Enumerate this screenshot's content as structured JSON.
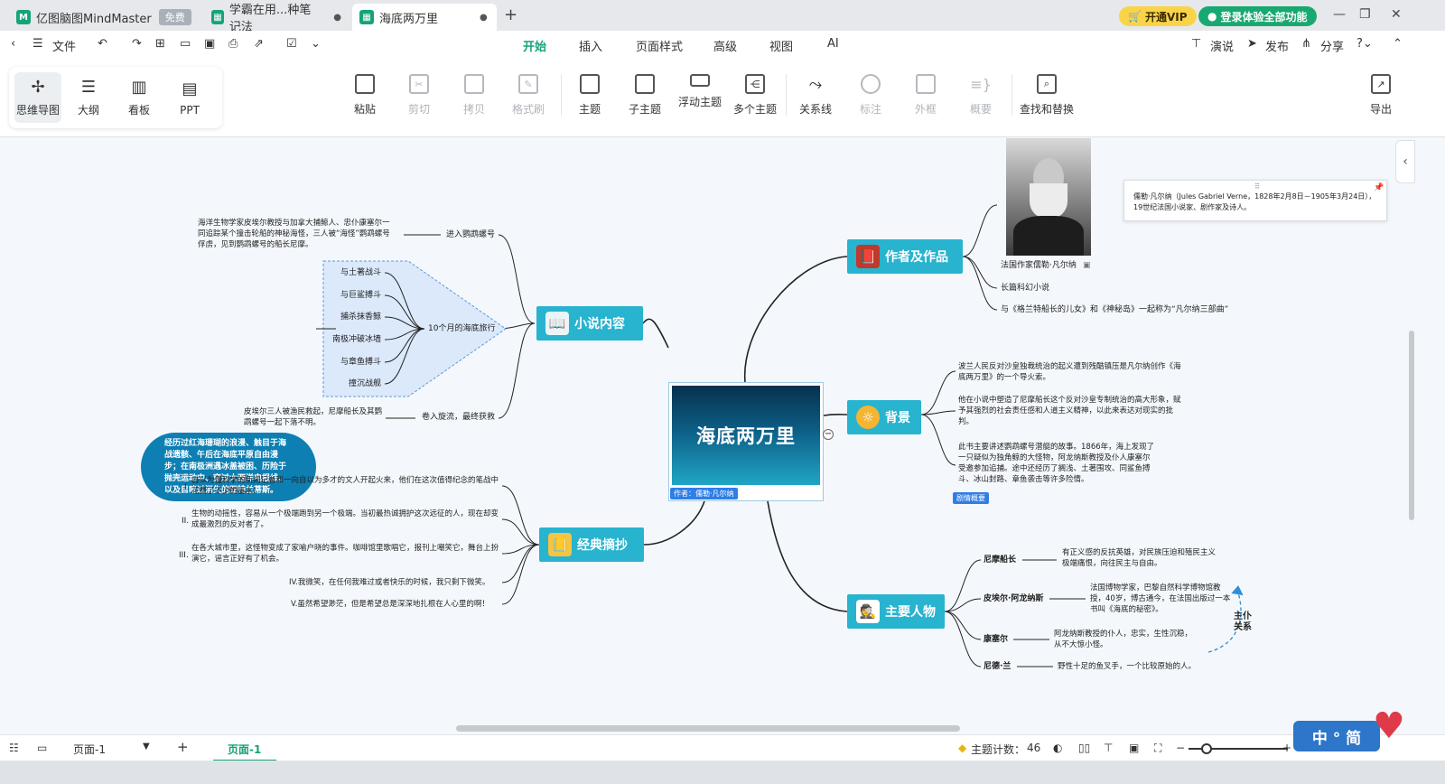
{
  "tabs": [
    {
      "label": "亿图脑图MindMaster",
      "badge": "免费"
    },
    {
      "label": "学霸在用...种笔记法"
    },
    {
      "label": "海底两万里"
    }
  ],
  "tab_add": "+",
  "header": {
    "vip": "开通VIP",
    "login": "登录体验全部功能"
  },
  "menu": {
    "file": "文件",
    "tabs": [
      "开始",
      "插入",
      "页面样式",
      "高级",
      "视图",
      "AI"
    ],
    "right": [
      "演说",
      "发布",
      "分享"
    ]
  },
  "views": [
    "思维导图",
    "大纲",
    "看板",
    "PPT"
  ],
  "ribbon": {
    "paste": "粘贴",
    "cut": "剪切",
    "copy": "拷贝",
    "format": "格式刷",
    "topic": "主题",
    "subtopic": "子主题",
    "float": "浮动主题",
    "multi": "多个主题",
    "relation": "关系线",
    "callout": "标注",
    "boundary": "外框",
    "summary": "概要",
    "find": "查找和替换",
    "export": "导出"
  },
  "map": {
    "center": "海底两万里",
    "center_tag": "作者：儒勒·凡尔纳",
    "branches": {
      "novel": "小说内容",
      "author": "作者及作品",
      "background": "背景",
      "quotes": "经典摘抄",
      "characters": "主要人物"
    },
    "novel": {
      "enter": "进入鹦鹉螺号",
      "enter_text": "海洋生物学家皮埃尔教授与加拿大捕鲸人、忠仆康塞尔一同追踪某个撞击轮船的神秘海怪，三人被“海怪”鹦鹉螺号俘虏，见到鹦鹉螺号的船长尼摩。",
      "journey": "10个月的海底旅行",
      "journey_items": [
        "与土著战斗",
        "与巨鲨搏斗",
        "捕杀抹香鲸",
        "南极冲破冰墙",
        "与章鱼搏斗",
        "撞沉战舰"
      ],
      "bubble": "经历过红海珊瑚的浪漫、触目于海战遗骸、午后在海底平原自由漫步；在南极洲遇冰盖被困、历险于抛壳运动中、穿过大西洋电报线、以及目睹过消失的亚特兰蒂斯。",
      "end": "卷入旋流，最终获救",
      "end_text": "皮埃尔三人被渔民救起，尼摩船长及其鹦鹉螺号一起下落不明。"
    },
    "author": {
      "photo_caption": "法国作家儒勒·凡尔纳",
      "note": "儒勒·凡尔纳（Jules Gabriel Verne，1828年2月8日－1905年3月24日），19世纪法国小说家、剧作家及诗人。",
      "genre": "长篇科幻小说",
      "trilogy": "与《格兰特船长的儿女》和《神秘岛》一起称为“凡尔纳三部曲”"
    },
    "background": {
      "p1": "波兰人民反对沙皇独裁统治的起义遭到残酷镇压是凡尔纳创作《海底两万里》的一个导火索。",
      "p2": "他在小说中塑造了尼摩船长这个反对沙皇专制统治的高大形象，赋予其强烈的社会责任感和人道主义精神，以此来表达对现实的批判。",
      "p3": "此书主要讲述鹦鹉螺号潜艇的故事。1866年，海上发现了一只疑似为独角鲸的大怪物，阿龙纳斯教授及仆人康塞尔受邀参加追捕。途中还经历了搁浅、土著围攻、同鲨鱼搏斗、冰山封路、章鱼袭击等许多险情。",
      "tag": "剧情概要"
    },
    "quotes": [
      {
        "num": "I.",
        "text": "自以为懂科学的新闻记者和一向自以为多才的文人开起火来，他们在这次值得纪念的笔战中花费了不少的墨水！"
      },
      {
        "num": "II.",
        "text": "生物的动摇性，容易从一个极端跑到另一个极端。当初最热诚拥护这次远征的人，现在却变成最激烈的反对者了。"
      },
      {
        "num": "III.",
        "text": "在各大城市里，这怪物变成了家喻户晓的事件。咖啡馆里歌唱它，报刊上嘲笑它，舞台上扮演它，谣言正好有了机会。"
      },
      {
        "num": "",
        "text": "IV.我微笑，在任何我难过或者快乐的时候，我只剩下微笑。"
      },
      {
        "num": "",
        "text": "V.虽然希望渺茫，但是希望总是深深地扎根在人心里的啊！"
      }
    ],
    "characters": [
      {
        "name": "尼摩船长",
        "desc": "有正义感的反抗英雄，对民族压迫和殖民主义极端痛恨，向往民主与自由。"
      },
      {
        "name": "皮埃尔·阿龙纳斯",
        "desc": "法国博物学家，巴黎自然科学博物馆教授，40岁，博古通今，在法国出版过一本书叫《海底的秘密》。"
      },
      {
        "name": "康塞尔",
        "desc": "阿龙纳斯教授的仆人，忠实，生性沉稳，从不大惊小怪。"
      },
      {
        "name": "尼德·兰",
        "desc": "野性十足的鱼叉手，一个比较原始的人。"
      }
    ],
    "master_servant": "主仆关系"
  },
  "status": {
    "page": "页面-1",
    "page_tab": "页面-1",
    "topic_count_label": "主题计数：",
    "topic_count": "46"
  },
  "ime": "中 ° 简",
  "colors": {
    "brand": "#16a37a",
    "branch": "#28b3cf",
    "bubble": "#0d7fb3"
  }
}
